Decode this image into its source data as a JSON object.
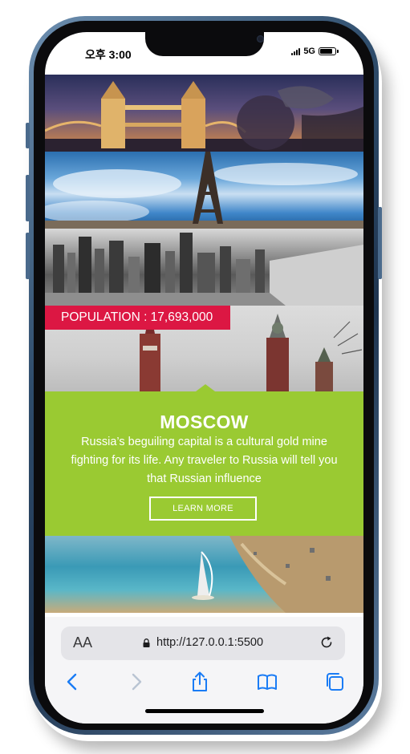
{
  "status_bar": {
    "time": "오후 3:00",
    "network": "5G"
  },
  "gallery": [
    {
      "name": "london-photo"
    },
    {
      "name": "paris-photo"
    },
    {
      "name": "new-york-photo"
    },
    {
      "name": "moscow-photo",
      "badge": "POPULATION : 17,693,000"
    },
    {
      "name": "dubai-photo"
    }
  ],
  "featured_city": {
    "title": "MOSCOW",
    "description": "Russia’s beguiling capital is a cultural gold mine fighting for its life. Any traveler to Russia will tell you that Russian influence",
    "button_label": "LEARN MORE"
  },
  "browser": {
    "text_size_label": "AA",
    "url": "http://127.0.0.1:5500"
  },
  "colors": {
    "badge": "#dc1743",
    "card": "#9aca32",
    "safari_blue": "#1a7cf5"
  }
}
